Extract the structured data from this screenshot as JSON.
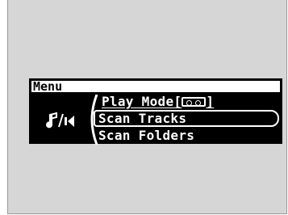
{
  "menu": {
    "title": "Menu",
    "source_icon": "music-note-icon",
    "items": [
      {
        "label_prefix": "Play Mode",
        "bracket_open": "[",
        "icon": "tape-icon",
        "bracket_close": "]"
      },
      {
        "label": "Scan Tracks",
        "selected": true
      },
      {
        "label": "Scan Folders"
      }
    ]
  },
  "colors": {
    "frame_bg": "#d6d6d6",
    "lcd_bg": "#000000",
    "lcd_text": "#ffffff"
  }
}
